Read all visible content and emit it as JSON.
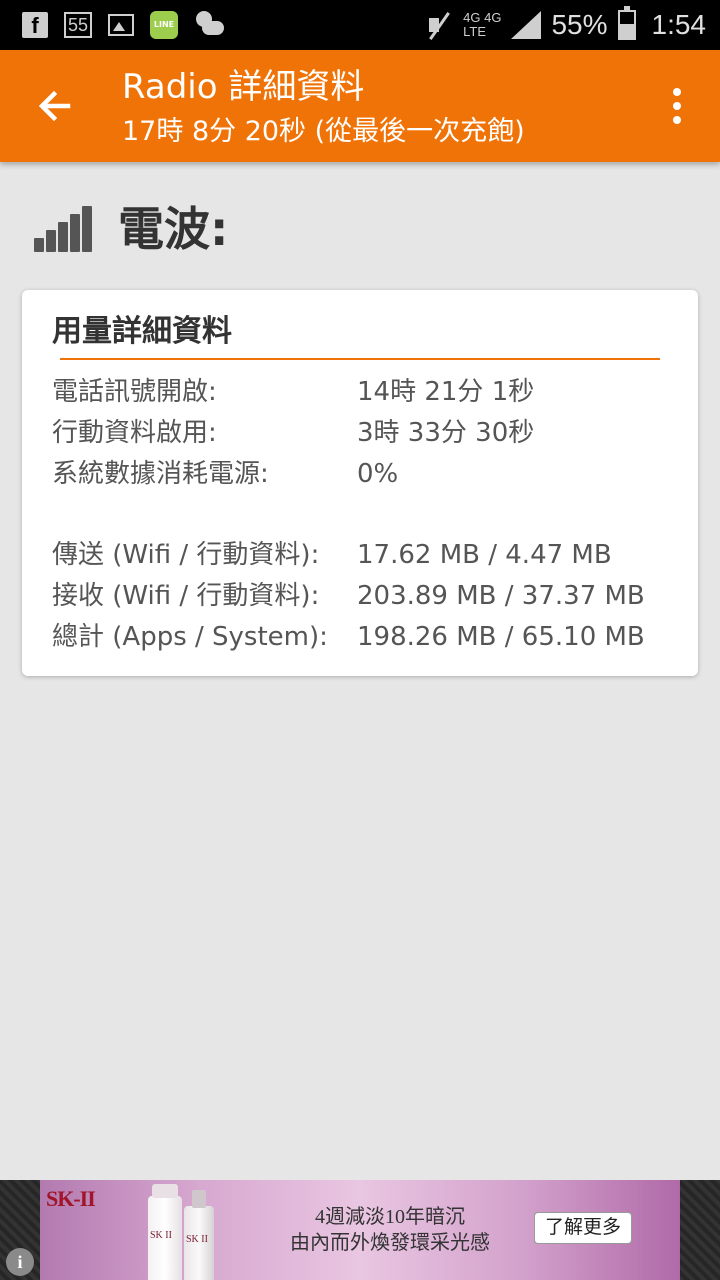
{
  "status_bar": {
    "notification_count": "55",
    "line_label": "LINE",
    "network_top": "4G 4G",
    "network_bottom": "LTE",
    "battery_percent": "55%",
    "time": "1:54"
  },
  "app_bar": {
    "title": "Radio 詳細資料",
    "subtitle": "17時 8分 20秒 (從最後一次充飽)"
  },
  "section": {
    "title": "電波:"
  },
  "usage_card": {
    "title": "用量詳細資料",
    "rows_top": [
      {
        "label": "電話訊號開啟:",
        "value": "14時 21分 1秒"
      },
      {
        "label": "行動資料啟用:",
        "value": "3時 33分 30秒"
      },
      {
        "label": "系統數據消耗電源:",
        "value": "0%"
      }
    ],
    "rows_bottom": [
      {
        "label": "傳送 (Wifi / 行動資料):",
        "value": "17.62 MB / 4.47 MB"
      },
      {
        "label": "接收 (Wifi / 行動資料):",
        "value": "203.89 MB / 37.37 MB"
      },
      {
        "label": "總計 (Apps / System):",
        "value": "198.26 MB / 65.10 MB"
      }
    ]
  },
  "ad": {
    "brand": "SK-II",
    "bottle_label": "SK II",
    "line1": "4週減淡10年暗沉",
    "line2": "由內而外煥發環采光感",
    "cta": "了解更多",
    "info_symbol": "i"
  }
}
